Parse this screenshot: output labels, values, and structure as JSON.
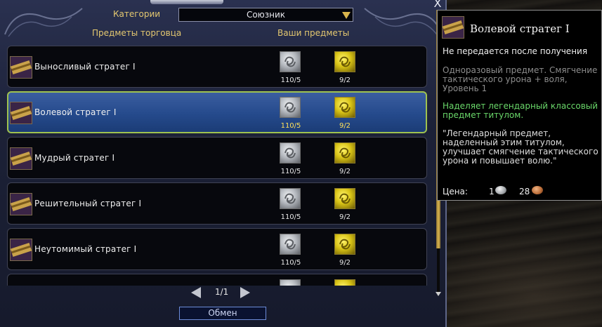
{
  "window": {
    "close_label": "X",
    "category_label": "Категории",
    "category_value": "Союзник",
    "col_vendor": "Предметы торговца",
    "col_yours": "Ваши предметы"
  },
  "items": [
    {
      "name": "Выносливый стратег I",
      "silver": "110/5",
      "gold": "9/2",
      "selected": false
    },
    {
      "name": "Волевой стратег I",
      "silver": "110/5",
      "gold": "9/2",
      "selected": true
    },
    {
      "name": "Мудрый стратег I",
      "silver": "110/5",
      "gold": "9/2",
      "selected": false
    },
    {
      "name": "Решительный стратег I",
      "silver": "110/5",
      "gold": "9/2",
      "selected": false
    },
    {
      "name": "Неутомимый стратег I",
      "silver": "110/5",
      "gold": "9/2",
      "selected": false
    }
  ],
  "pager": {
    "text": "1/1"
  },
  "trade_button": "Обмен",
  "tooltip": {
    "title": "Волевой стратег I",
    "bind": "Не передается после получения",
    "desc": "Одноразовый предмет. Смягчение тактического урона + воля, Уровень 1",
    "effect": "Наделяет легендарный классовый предмет титулом.",
    "quote": "\"Легендарный предмет, наделенный этим титулом, улучшает смягчение тактического урона и повышает волю.\"",
    "price_label": "Цена:",
    "price_silver": "1",
    "price_copper": "28"
  }
}
